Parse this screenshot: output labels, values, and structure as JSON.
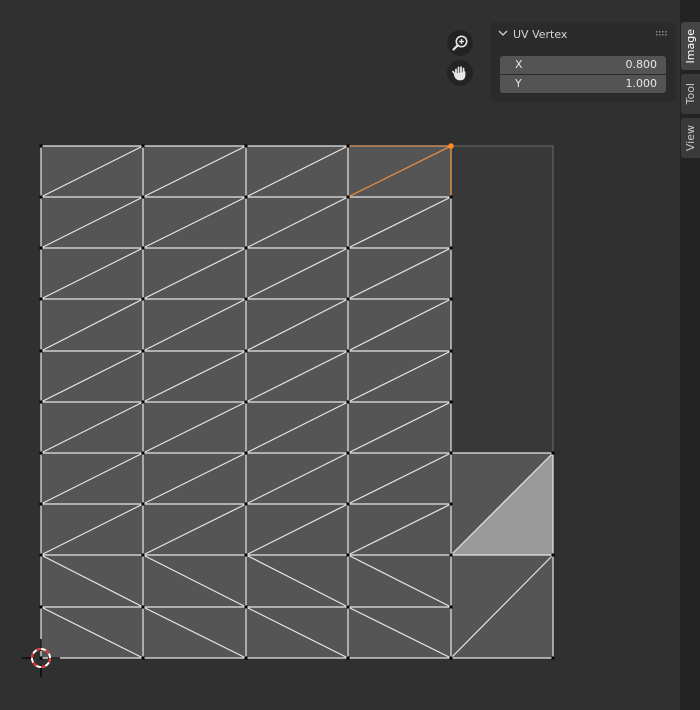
{
  "panel": {
    "title": "UV Vertex",
    "fields": [
      {
        "label": "X",
        "value": "0.800"
      },
      {
        "label": "Y",
        "value": "1.000"
      }
    ]
  },
  "sidebar": {
    "tabs": [
      {
        "label": "Image",
        "active": true
      },
      {
        "label": "Tool",
        "active": false
      },
      {
        "label": "View",
        "active": false
      }
    ]
  },
  "viewport": {
    "tools": [
      "zoom-icon",
      "hand-pan-icon"
    ],
    "cursor": "2d-cursor-icon"
  },
  "colors": {
    "background": "#303030",
    "face": "#555555",
    "face_selected": "#999999",
    "edge": "#e6e6e6",
    "edge_selected": "#ff8c26",
    "vertex": "#000000"
  }
}
